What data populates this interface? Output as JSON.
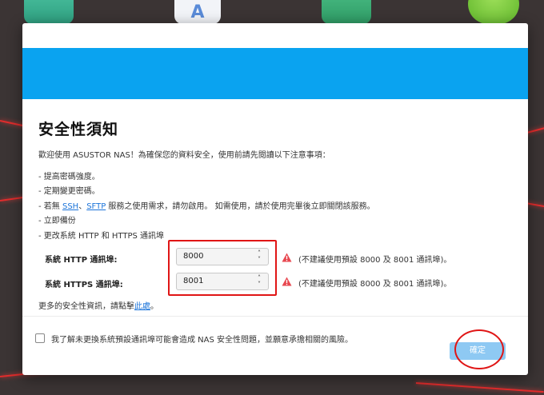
{
  "dialog": {
    "title": "安全性須知",
    "intro": "歡迎使用 ASUSTOR NAS！為確保您的資料安全，使用前請先閱讀以下注意事項：",
    "items": [
      "- 提高密碼強度。",
      "- 定期變更密碼。",
      "- 立即備份",
      "- 更改系統 HTTP 和 HTTPS  通訊埠"
    ],
    "services_item": {
      "prefix": "- 若無 ",
      "link_ssh": "SSH",
      "sep": "、",
      "link_sftp": "SFTP",
      "suffix": " 服務之使用需求，請勿啟用。  如需使用，請於使用完畢後立即關閉該服務。"
    },
    "http": {
      "label": "系統 HTTP 通訊埠:",
      "value": "8000",
      "warning": "(不建議使用預設 8000 及 8001 通訊埠)。"
    },
    "https": {
      "label": "系統 HTTPS 通訊埠:",
      "value": "8001",
      "warning": "(不建議使用預設 8000 及 8001 通訊埠)。"
    },
    "more_info": {
      "prefix": "更多的安全性資訊，請點擊",
      "link": "此處",
      "suffix": "。"
    },
    "agree_text": "我了解未更換系統預設通訊埠可能會造成 NAS 安全性問題，並願意承擔相關的風險。",
    "ok_label": "確定"
  },
  "colors": {
    "banner": "#0aa3f0",
    "link": "#1a73d9",
    "warning": "#e8474f",
    "ok_button": "#8ec9f3",
    "highlight": "#e01515"
  },
  "icons": {
    "warning": "warning-triangle-icon",
    "select_arrows": "chevron-up-down-icon"
  }
}
